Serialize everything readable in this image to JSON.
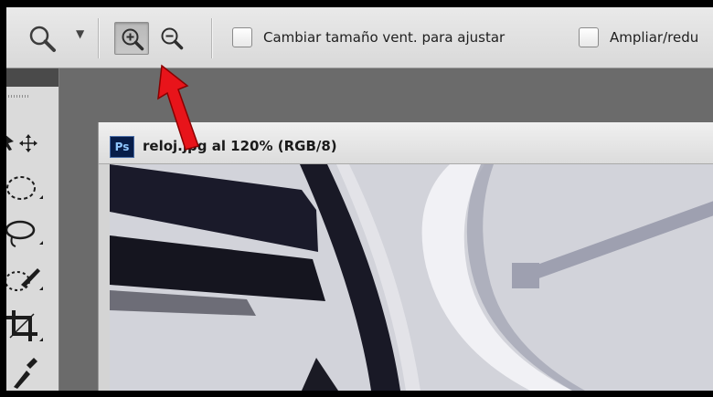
{
  "options_bar": {
    "tool_preset_icon": "zoom-icon",
    "preset_dropdown_icon": "triangle-down-icon",
    "zoom_in_icon": "zoom-in-icon",
    "zoom_out_icon": "zoom-out-icon",
    "resize_windows_label": "Cambiar tamaño vent. para ajustar",
    "zoom_all_label": "Ampliar/redu"
  },
  "tools_panel": {
    "tools": [
      "move-tool-icon",
      "marquee-tool-icon",
      "lasso-tool-icon",
      "quick-selection-tool-icon",
      "crop-tool-icon",
      "eyedropper-tool-icon"
    ]
  },
  "document": {
    "badge": "Ps",
    "title": "reloj.jpg al 120% (RGB/8)"
  },
  "colors": {
    "annotation_arrow": "#e8141a",
    "ps_badge_bg": "#071d49"
  }
}
